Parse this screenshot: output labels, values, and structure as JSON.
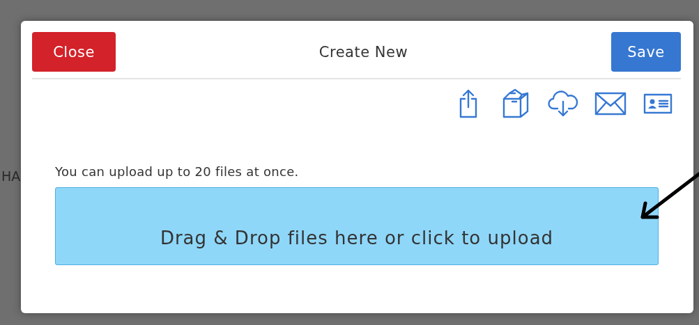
{
  "background_page": {
    "text_fragment": "HA"
  },
  "dialog": {
    "title": "Create New",
    "close_button": "Close",
    "save_button": "Save",
    "toolbar_icons": [
      {
        "kind": "share"
      },
      {
        "kind": "box"
      },
      {
        "kind": "cloud-download"
      },
      {
        "kind": "mail"
      },
      {
        "kind": "contact-card"
      }
    ],
    "hint": "You can upload up to 20 files at once.",
    "dropzone": {
      "label": "Drag & Drop files here or click to upload"
    }
  },
  "annotation": {
    "kind": "arrow"
  }
}
